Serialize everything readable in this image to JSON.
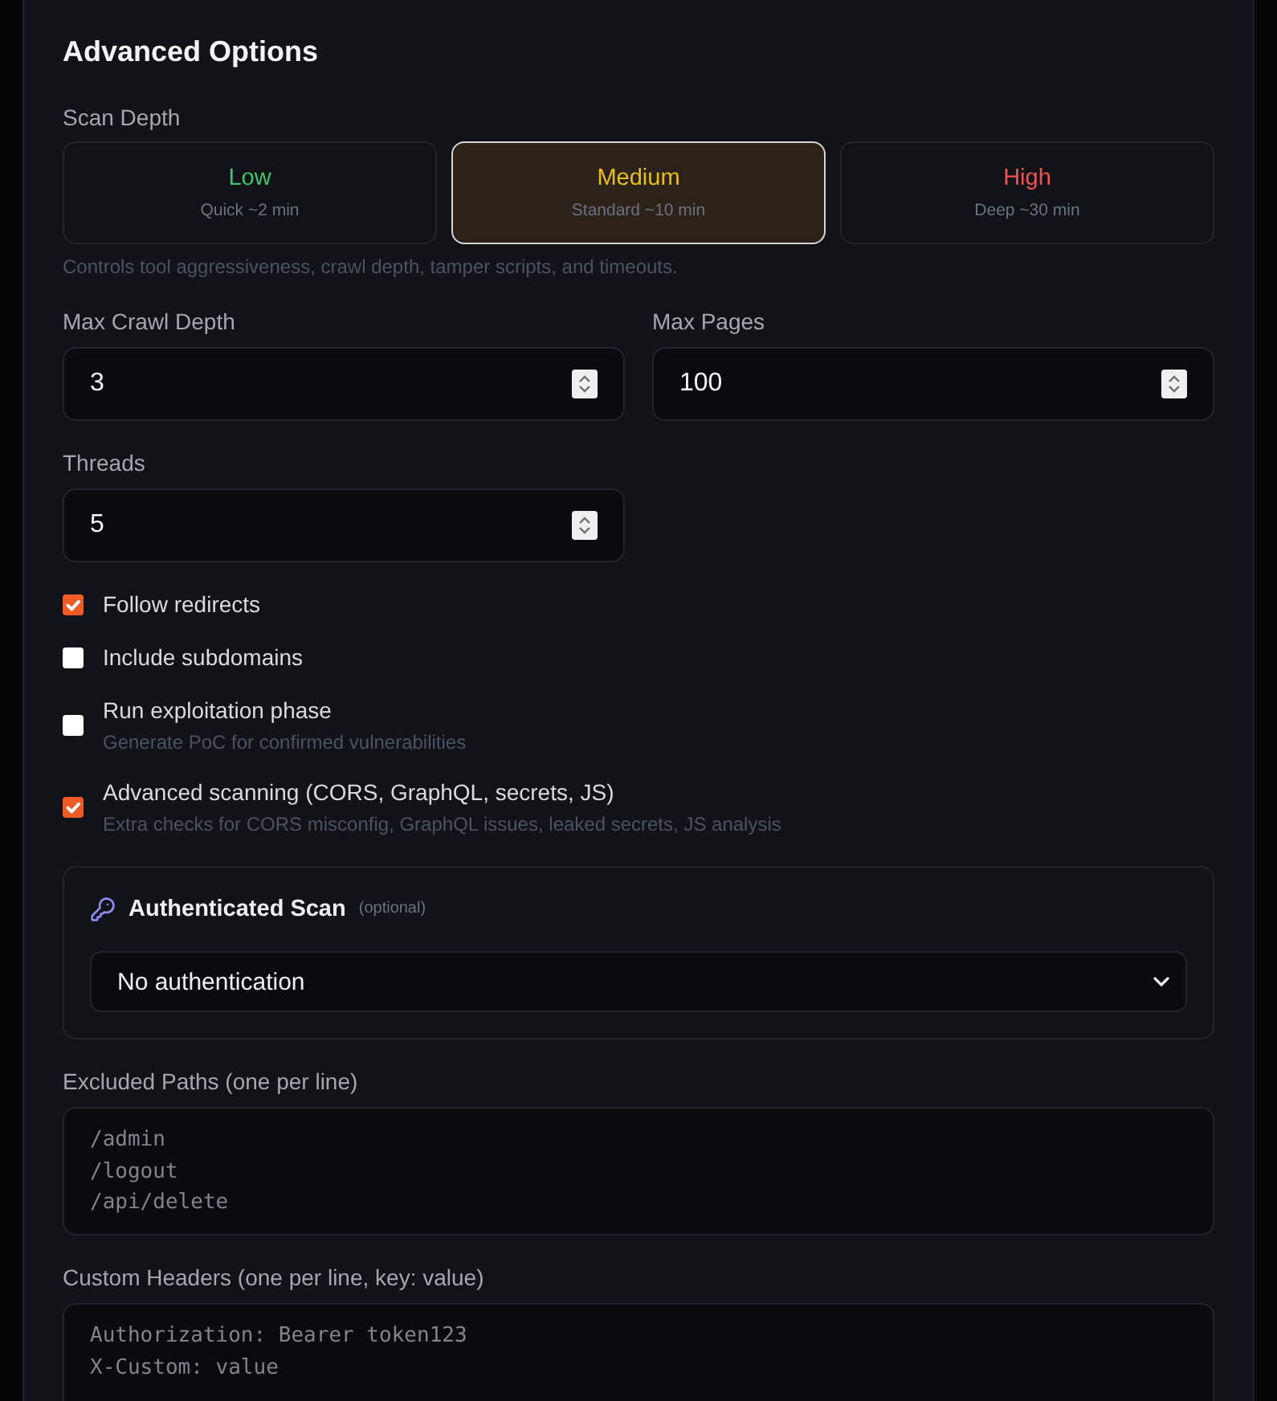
{
  "panel": {
    "title": "Advanced Options"
  },
  "scan_depth": {
    "label": "Scan Depth",
    "options": [
      {
        "name": "Low",
        "detail": "Quick ~2 min",
        "color": "#3ec46d",
        "selected": false
      },
      {
        "name": "Medium",
        "detail": "Standard ~10 min",
        "color": "#e6c10f",
        "selected": true
      },
      {
        "name": "High",
        "detail": "Deep ~30 min",
        "color": "#ef5350",
        "selected": false
      }
    ],
    "help": "Controls tool aggressiveness, crawl depth, tamper scripts, and timeouts."
  },
  "number_fields": [
    {
      "label": "Max Crawl Depth",
      "value": "3"
    },
    {
      "label": "Max Pages",
      "value": "100"
    },
    {
      "label": "Threads",
      "value": "5"
    }
  ],
  "options": [
    {
      "label": "Follow redirects",
      "checked": true
    },
    {
      "label": "Include subdomains",
      "checked": false
    },
    {
      "label": "Run exploitation phase",
      "description": "Generate PoC for confirmed vulnerabilities",
      "checked": false
    },
    {
      "label": "Advanced scanning (CORS, GraphQL, secrets, JS)",
      "description": "Extra checks for CORS misconfig, GraphQL issues, leaked secrets, JS analysis",
      "checked": true
    }
  ],
  "authenticated_scan": {
    "title": "Authenticated Scan",
    "note": "(optional)",
    "select": {
      "value": "No authentication"
    }
  },
  "excluded_paths": {
    "label": "Excluded Paths (one per line)",
    "placeholder": "/admin\n/logout\n/api/delete"
  },
  "custom_headers": {
    "label": "Custom Headers (one per line, key: value)",
    "placeholder": "Authorization: Bearer token123\nX-Custom: value"
  }
}
